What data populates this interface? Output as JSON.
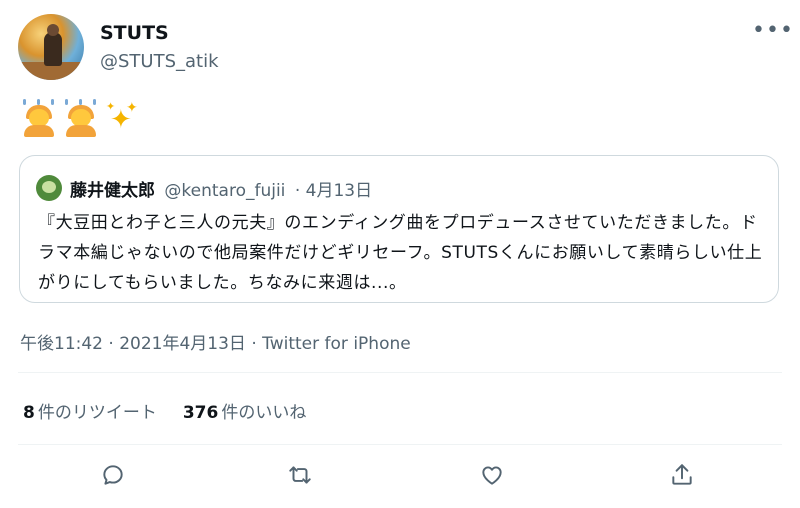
{
  "author": {
    "name": "STUTS",
    "handle": "@STUTS_atik"
  },
  "tweet": {
    "emoji": [
      "person-raising-hands",
      "person-raising-hands",
      "sparkles"
    ]
  },
  "quoted": {
    "name": "藤井健太郎",
    "handle": "@kentaro_fujii",
    "date": "· 4月13日",
    "text": "『大豆田とわ子と三人の元夫』のエンディング曲をプロデュースさせていただきました。ドラマ本編じゃないので他局案件だけどギリセーフ。STUTSくんにお願いして素晴らしい仕上がりにしてもらいました。ちなみに来週は...。"
  },
  "meta": {
    "time": "午後11:42",
    "date": "2021年4月13日",
    "separator": " · ",
    "client": "Twitter for iPhone"
  },
  "stats": {
    "retweets_count": "8",
    "retweets_label": "件のリツイート",
    "likes_count": "376",
    "likes_label": "件のいいね"
  },
  "actions": [
    "reply-icon",
    "retweet-icon",
    "like-icon",
    "share-icon"
  ],
  "colors": {
    "text": "#0f1419",
    "secondary": "#536471",
    "border": "#cfd9de",
    "divider": "#eff3f4"
  }
}
